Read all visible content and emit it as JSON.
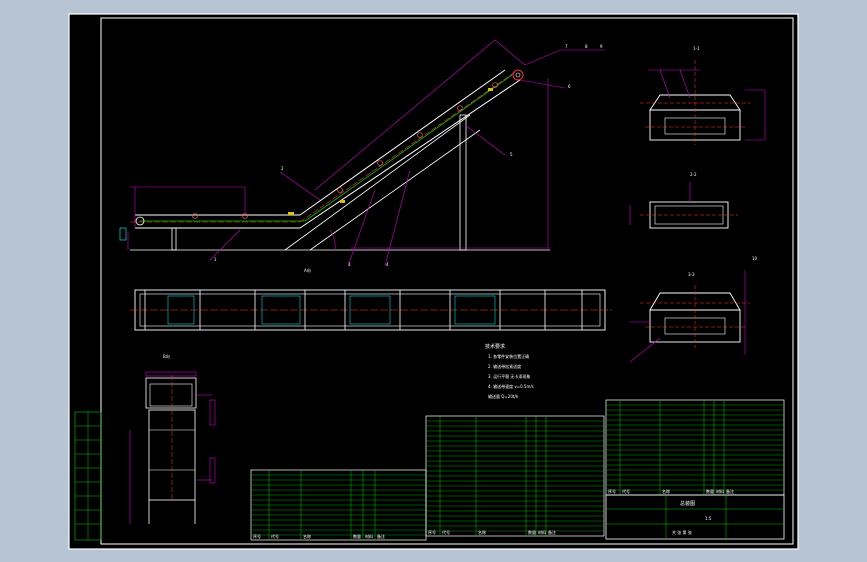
{
  "drawing": {
    "title_block": {
      "drawing_name": "总装图",
      "scale": "1:5",
      "sheet_label": "共 张 第 张"
    },
    "view_labels": {
      "front_view": "A向",
      "side_view": "B向",
      "section_1": "1-1",
      "section_2": "2-2",
      "section_3": "3-3"
    },
    "tech_notes": {
      "heading": "技术要求",
      "lines": [
        "1. 各零件安装位置正确",
        "2. 输送带松紧适度",
        "3. 运行平稳 无卡滞现象",
        "4. 输送带速度 v=0.5m/s",
        "   输送量 Q=20t/h"
      ]
    },
    "balloons": [
      "1",
      "2",
      "3",
      "4",
      "5",
      "6",
      "7",
      "8",
      "9",
      "10"
    ],
    "bom_headers": [
      "序号",
      "代号",
      "名称",
      "数量",
      "材料",
      "备注"
    ],
    "colors": {
      "background": "#000000",
      "border": "#ffffff",
      "grid": "#00c800",
      "leader": "#c800c8",
      "center": "#ff3030",
      "part": "#ffffff",
      "accent": "#00ffff"
    }
  }
}
